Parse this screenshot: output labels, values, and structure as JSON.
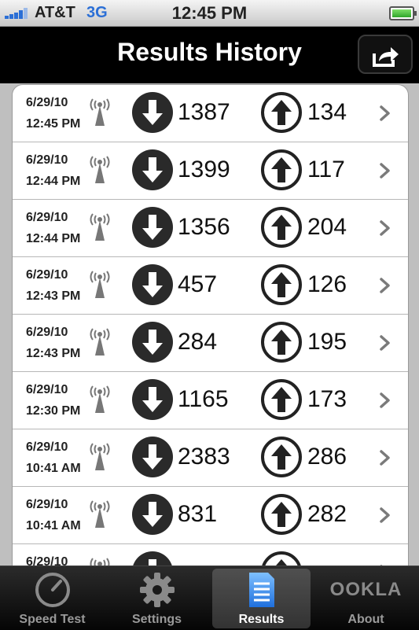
{
  "status_bar": {
    "carrier": "AT&T",
    "network": "3G",
    "time": "12:45 PM"
  },
  "nav": {
    "title": "Results History"
  },
  "results": [
    {
      "date": "6/29/10",
      "time": "12:45 PM",
      "download": "1387",
      "upload": "134"
    },
    {
      "date": "6/29/10",
      "time": "12:44 PM",
      "download": "1399",
      "upload": "117"
    },
    {
      "date": "6/29/10",
      "time": "12:44 PM",
      "download": "1356",
      "upload": "204"
    },
    {
      "date": "6/29/10",
      "time": "12:43 PM",
      "download": "457",
      "upload": "126"
    },
    {
      "date": "6/29/10",
      "time": "12:43 PM",
      "download": "284",
      "upload": "195"
    },
    {
      "date": "6/29/10",
      "time": "12:30 PM",
      "download": "1165",
      "upload": "173"
    },
    {
      "date": "6/29/10",
      "time": "10:41 AM",
      "download": "2383",
      "upload": "286"
    },
    {
      "date": "6/29/10",
      "time": "10:41 AM",
      "download": "831",
      "upload": "282"
    },
    {
      "date": "6/29/10",
      "time": "",
      "download": "",
      "upload": ""
    }
  ],
  "tabs": [
    {
      "label": "Speed Test",
      "icon": "speedometer-icon",
      "selected": false
    },
    {
      "label": "Settings",
      "icon": "gear-icon",
      "selected": false
    },
    {
      "label": "Results",
      "icon": "document-icon",
      "selected": true
    },
    {
      "label": "About",
      "icon": "ookla-logo",
      "selected": false
    }
  ],
  "brand": {
    "logo_text": "OOKLA"
  },
  "colors": {
    "accent": "#2b6fd6",
    "nav_background": "#000000"
  }
}
